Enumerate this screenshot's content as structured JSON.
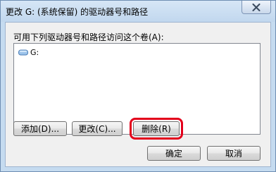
{
  "window": {
    "title": "更改 G: (系统保留) 的驱动器号和路径"
  },
  "prompt": "可用下列驱动器号和路径访问这个卷(A):",
  "list": {
    "items": [
      {
        "label": "G:",
        "icon": "drive-icon"
      }
    ]
  },
  "buttons": {
    "add": "添加(D)...",
    "change": "更改(C)...",
    "remove": "删除(R)",
    "ok": "确定",
    "cancel": "取消"
  },
  "colors": {
    "highlight": "#e3001b",
    "titlebar": "#c5dbf0"
  }
}
